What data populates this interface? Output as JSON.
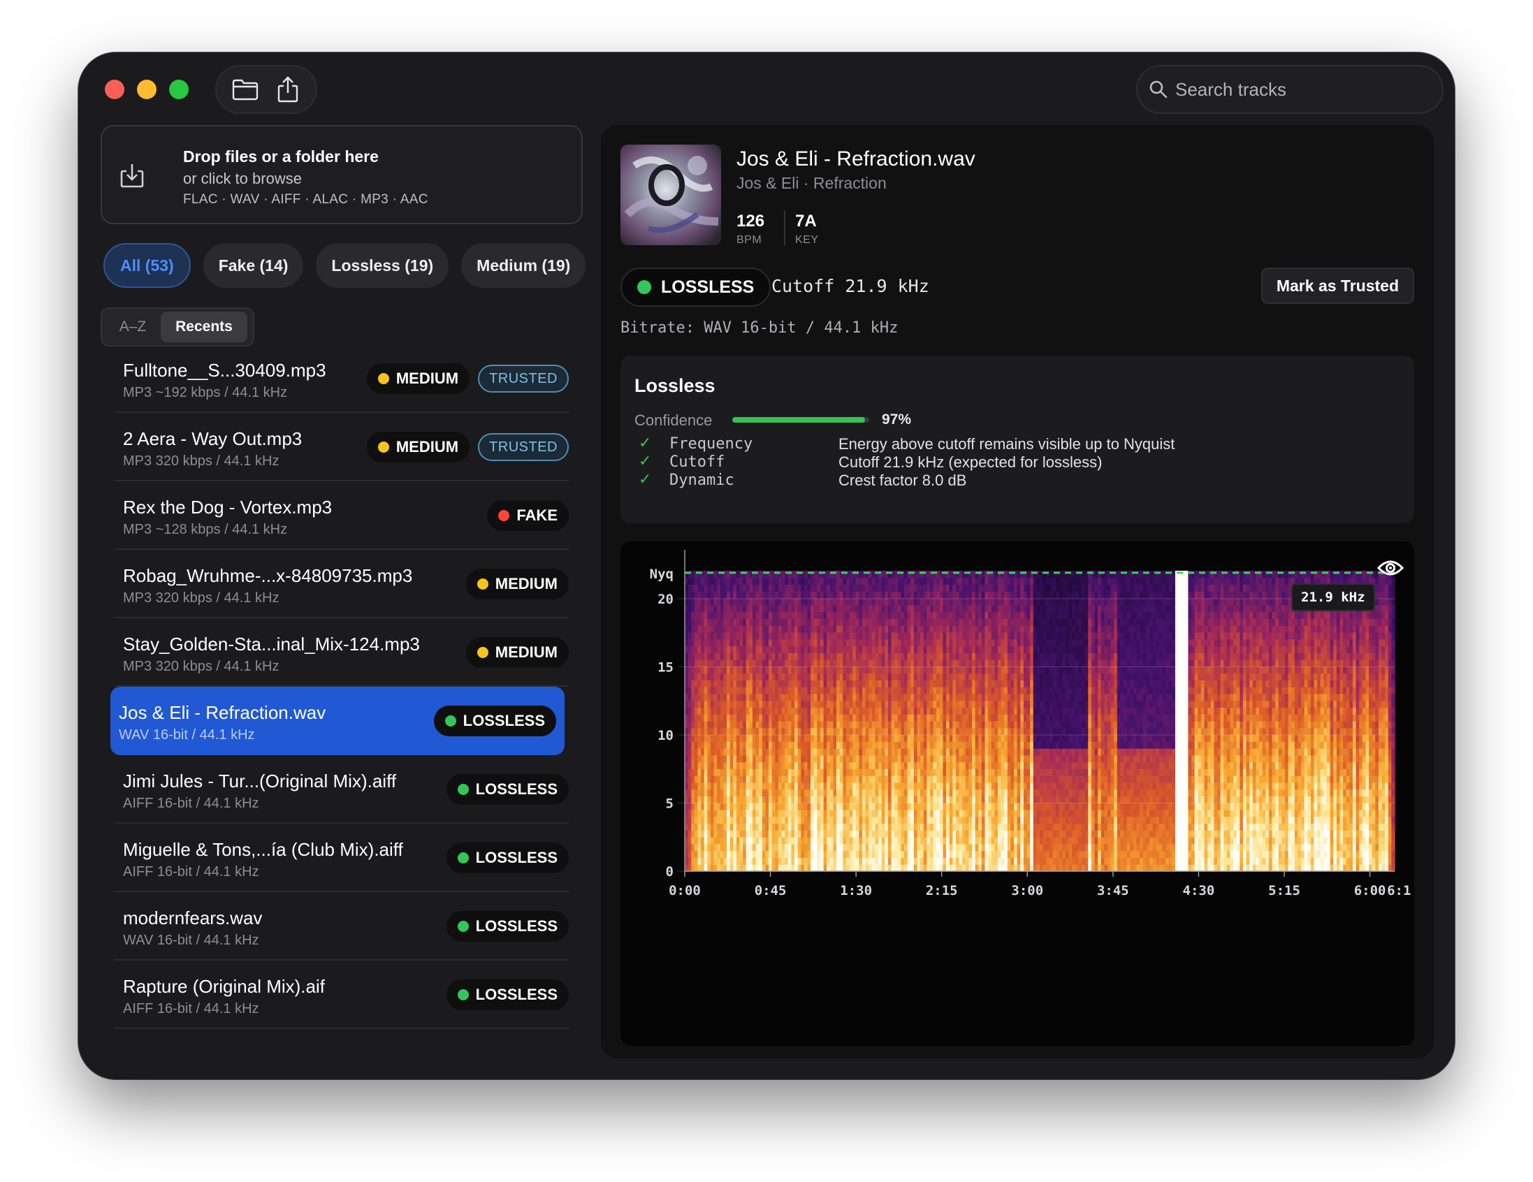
{
  "search": {
    "placeholder": "Search tracks"
  },
  "toolbar": {
    "open_icon": "folder-icon",
    "share_icon": "share-icon"
  },
  "dropzone": {
    "title": "Drop files or a folder here",
    "subtitle": "or click to browse",
    "formats": "FLAC · WAV · AIFF · ALAC · MP3 · AAC"
  },
  "filters": [
    {
      "label": "All (53)",
      "active": true
    },
    {
      "label": "Fake (14)",
      "active": false
    },
    {
      "label": "Lossless (19)",
      "active": false
    },
    {
      "label": "Medium (19)",
      "active": false
    }
  ],
  "sort": {
    "az": "A–Z",
    "recents": "Recents",
    "selected": "Recents"
  },
  "tracks": [
    {
      "name": "Fulltone__S...30409.mp3",
      "meta": "MP3 ~192 kbps / 44.1 kHz",
      "status": "MEDIUM",
      "trusted": "TRUSTED",
      "selected": false
    },
    {
      "name": "2 Aera - Way Out.mp3",
      "meta": "MP3 320 kbps / 44.1 kHz",
      "status": "MEDIUM",
      "trusted": "TRUSTED",
      "selected": false
    },
    {
      "name": "Rex the Dog - Vortex.mp3",
      "meta": "MP3 ~128 kbps / 44.1 kHz",
      "status": "FAKE",
      "trusted": "",
      "selected": false
    },
    {
      "name": "Robag_Wruhme-...x-84809735.mp3",
      "meta": "MP3 320 kbps / 44.1 kHz",
      "status": "MEDIUM",
      "trusted": "",
      "selected": false
    },
    {
      "name": "Stay_Golden-Sta...inal_Mix-124.mp3",
      "meta": "MP3 320 kbps / 44.1 kHz",
      "status": "MEDIUM",
      "trusted": "",
      "selected": false
    },
    {
      "name": "Jos & Eli - Refraction.wav",
      "meta": "WAV 16-bit / 44.1 kHz",
      "status": "LOSSLESS",
      "trusted": "",
      "selected": true
    },
    {
      "name": "Jimi Jules - Tur...(Original Mix).aiff",
      "meta": "AIFF 16-bit / 44.1 kHz",
      "status": "LOSSLESS",
      "trusted": "",
      "selected": false
    },
    {
      "name": "Miguelle & Tons,...ía (Club Mix).aiff",
      "meta": "AIFF 16-bit / 44.1 kHz",
      "status": "LOSSLESS",
      "trusted": "",
      "selected": false
    },
    {
      "name": "modernfears.wav",
      "meta": "WAV 16-bit / 44.1 kHz",
      "status": "LOSSLESS",
      "trusted": "",
      "selected": false
    },
    {
      "name": "Rapture (Original Mix).aif",
      "meta": "AIFF 16-bit / 44.1 kHz",
      "status": "LOSSLESS",
      "trusted": "",
      "selected": false
    }
  ],
  "status_colors": {
    "MEDIUM": "#f5c518",
    "FAKE": "#ff453a",
    "LOSSLESS": "#32c75a"
  },
  "detail": {
    "title": "Jos & Eli - Refraction.wav",
    "subtitle": "Jos & Eli · Refraction",
    "bpm": "126",
    "bpm_label": "BPM",
    "key": "7A",
    "key_label": "KEY",
    "status": "LOSSLESS",
    "cutoff": "Cutoff 21.9 kHz",
    "trust_button": "Mark as Trusted",
    "bitrate": "Bitrate: WAV 16-bit / 44.1 kHz",
    "analysis": {
      "title": "Lossless",
      "confidence_label": "Confidence",
      "confidence": 0.97,
      "confidence_text": "97%",
      "checks": [
        {
          "key": "Frequency",
          "desc": "Energy above cutoff remains visible up to Nyquist"
        },
        {
          "key": "Cutoff",
          "desc": "Cutoff 21.9 kHz (expected for lossless)"
        },
        {
          "key": "Dynamic",
          "desc": "Crest factor 8.0 dB"
        }
      ]
    },
    "spectrogram": {
      "cutoff_tag": "21.9 kHz",
      "nyquist_label": "Nyq",
      "y_ticks": [
        "0",
        "5",
        "10",
        "15",
        "20"
      ],
      "y_tick_values": [
        0,
        5,
        10,
        15,
        20
      ],
      "y_max_khz": 22.05,
      "cutoff_khz": 21.9,
      "x_ticks": [
        "0:00",
        "0:45",
        "1:30",
        "2:15",
        "3:00",
        "3:45",
        "4:30",
        "5:15",
        "6:00"
      ],
      "x_tick_seconds": [
        0,
        45,
        90,
        135,
        180,
        225,
        270,
        315,
        360
      ],
      "trailing_label": "6:1",
      "trailing_label_seconds": 369,
      "duration_s": 373,
      "breakdowns": [
        {
          "start_s": 183,
          "end_s": 212,
          "level": 0.1
        },
        {
          "start_s": 213,
          "end_s": 226,
          "level": 0.7
        },
        {
          "start_s": 228,
          "end_s": 258,
          "level": 0.15
        },
        {
          "start_s": 258,
          "end_s": 264,
          "level": 1.0
        }
      ]
    }
  }
}
